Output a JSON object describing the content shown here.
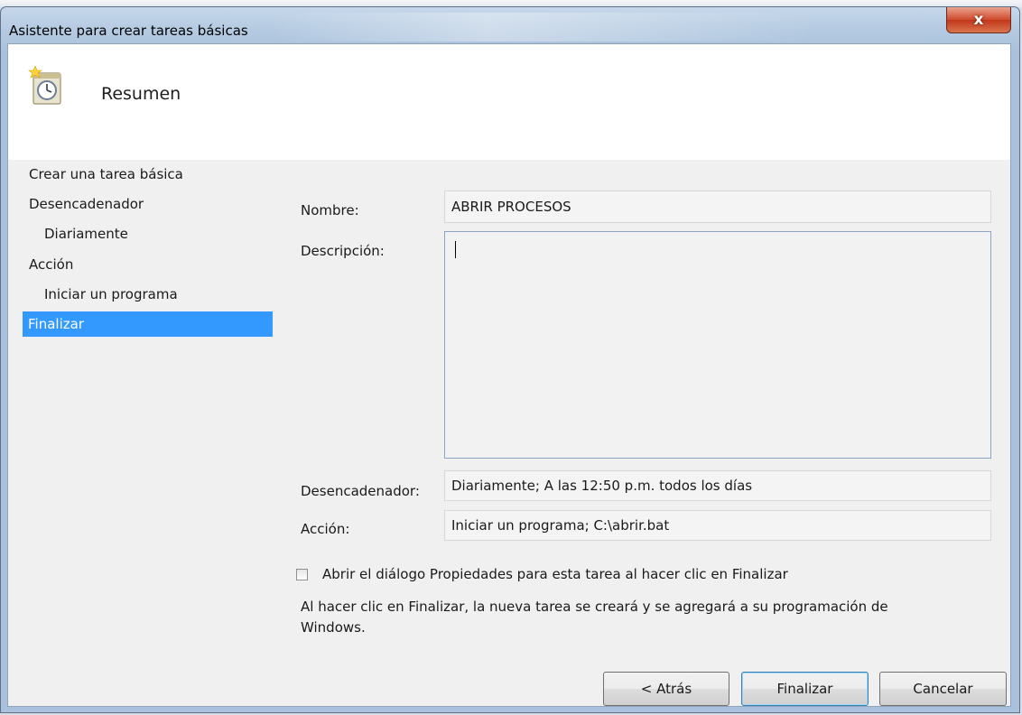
{
  "window": {
    "title": "Asistente para crear tareas básicas",
    "close_glyph": "x"
  },
  "header": {
    "title": "Resumen",
    "icon": "clock-wizard-icon"
  },
  "nav": {
    "items": [
      {
        "label": "Crear una tarea básica"
      },
      {
        "label": "Desencadenador"
      },
      {
        "label": "Diariamente"
      },
      {
        "label": "Acción"
      },
      {
        "label": "Iniciar un programa"
      },
      {
        "label": "Finalizar"
      }
    ],
    "selected_index": 5,
    "selected_color": "#3399ff"
  },
  "form": {
    "name_label": "Nombre:",
    "name_value": "ABRIR PROCESOS",
    "description_label": "Descripción:",
    "description_value": "",
    "trigger_label": "Desencadenador:",
    "trigger_value": "Diariamente; A las 12:50 p.m. todos los días",
    "action_label": "Acción:",
    "action_value": "Iniciar un programa; C:\\abrir.bat",
    "open_properties_checkbox_label": "Abrir el diálogo Propiedades para esta tarea al hacer clic en Finalizar",
    "open_properties_checked": false,
    "info_text_line1": "Al hacer clic en Finalizar, la nueva tarea se creará y se agregará a su programación de",
    "info_text_line2": "Windows."
  },
  "buttons": {
    "back": "< Atrás",
    "finish": "Finalizar",
    "cancel": "Cancelar"
  }
}
